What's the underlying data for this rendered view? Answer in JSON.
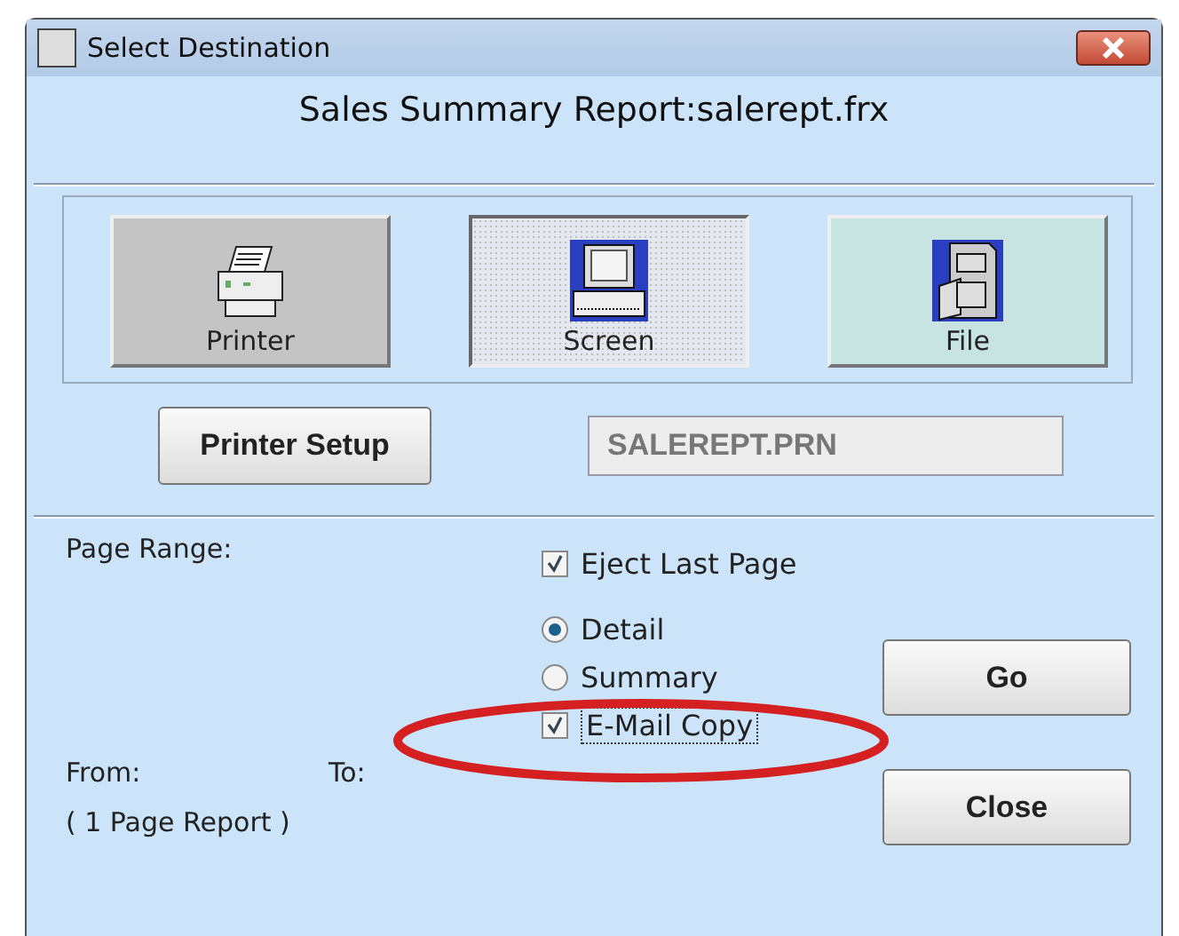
{
  "window": {
    "title": "Select Destination"
  },
  "report_title": "Sales Summary Report:salerept.frx",
  "destinations": [
    {
      "label": "Printer",
      "kind": "printer",
      "selected": false,
      "color": "#c4c4c4"
    },
    {
      "label": "Screen",
      "kind": "screen",
      "selected": true,
      "color": "#e4e8ee"
    },
    {
      "label": "File",
      "kind": "file",
      "selected": false,
      "color": "#c8e4e2"
    }
  ],
  "printer_setup_button": "Printer Setup",
  "file_field": {
    "value": "SALEREPT.PRN",
    "disabled": true
  },
  "page_range_label": "Page Range:",
  "options": [
    {
      "kind": "checkbox",
      "label": "Eject Last Page",
      "checked": true
    },
    {
      "kind": "radio",
      "label": "Detail",
      "selected": true
    },
    {
      "kind": "radio",
      "label": "Summary",
      "selected": false
    },
    {
      "kind": "checkbox",
      "label": "E-Mail Copy",
      "checked": true,
      "highlighted": true
    }
  ],
  "buttons": [
    "Go",
    "Close"
  ],
  "from_label": "From:",
  "to_label": "To:",
  "page_count": "( 1 Page Report )"
}
